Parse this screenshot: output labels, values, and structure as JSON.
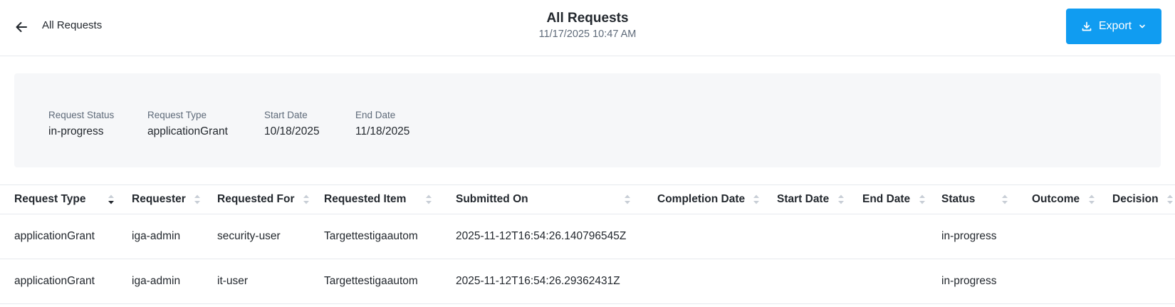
{
  "header": {
    "back_label": "All Requests",
    "title": "All Requests",
    "subtitle": "11/17/2025 10:47 AM",
    "export_label": "Export"
  },
  "filters": [
    {
      "label": "Request Status",
      "value": "in-progress"
    },
    {
      "label": "Request Type",
      "value": "applicationGrant"
    },
    {
      "label": "Start Date",
      "value": "10/18/2025"
    },
    {
      "label": "End Date",
      "value": "11/18/2025"
    }
  ],
  "table": {
    "columns": [
      "Request Type",
      "Requester",
      "Requested For",
      "Requested Item",
      "Submitted On",
      "Completion Date",
      "Start Date",
      "End Date",
      "Status",
      "Outcome",
      "Decision"
    ],
    "rows": [
      [
        "applicationGrant",
        "iga-admin",
        "security-user",
        "Targettestigaautom",
        "2025-11-12T16:54:26.140796545Z",
        "",
        "",
        "",
        "in-progress",
        "",
        ""
      ],
      [
        "applicationGrant",
        "iga-admin",
        "it-user",
        "Targettestigaautom",
        "2025-11-12T16:54:26.29362431Z",
        "",
        "",
        "",
        "in-progress",
        "",
        ""
      ]
    ]
  },
  "colors": {
    "accent": "#109cf1",
    "panel": "#f6f7f9",
    "border": "#e6e9ee",
    "muted_text": "#5e6a79"
  },
  "icons": {
    "back": "arrow-left-icon",
    "export": "download-icon",
    "export_caret": "chevron-down-icon",
    "sort": "sort-icon",
    "sort_active": "sort-desc-icon"
  }
}
